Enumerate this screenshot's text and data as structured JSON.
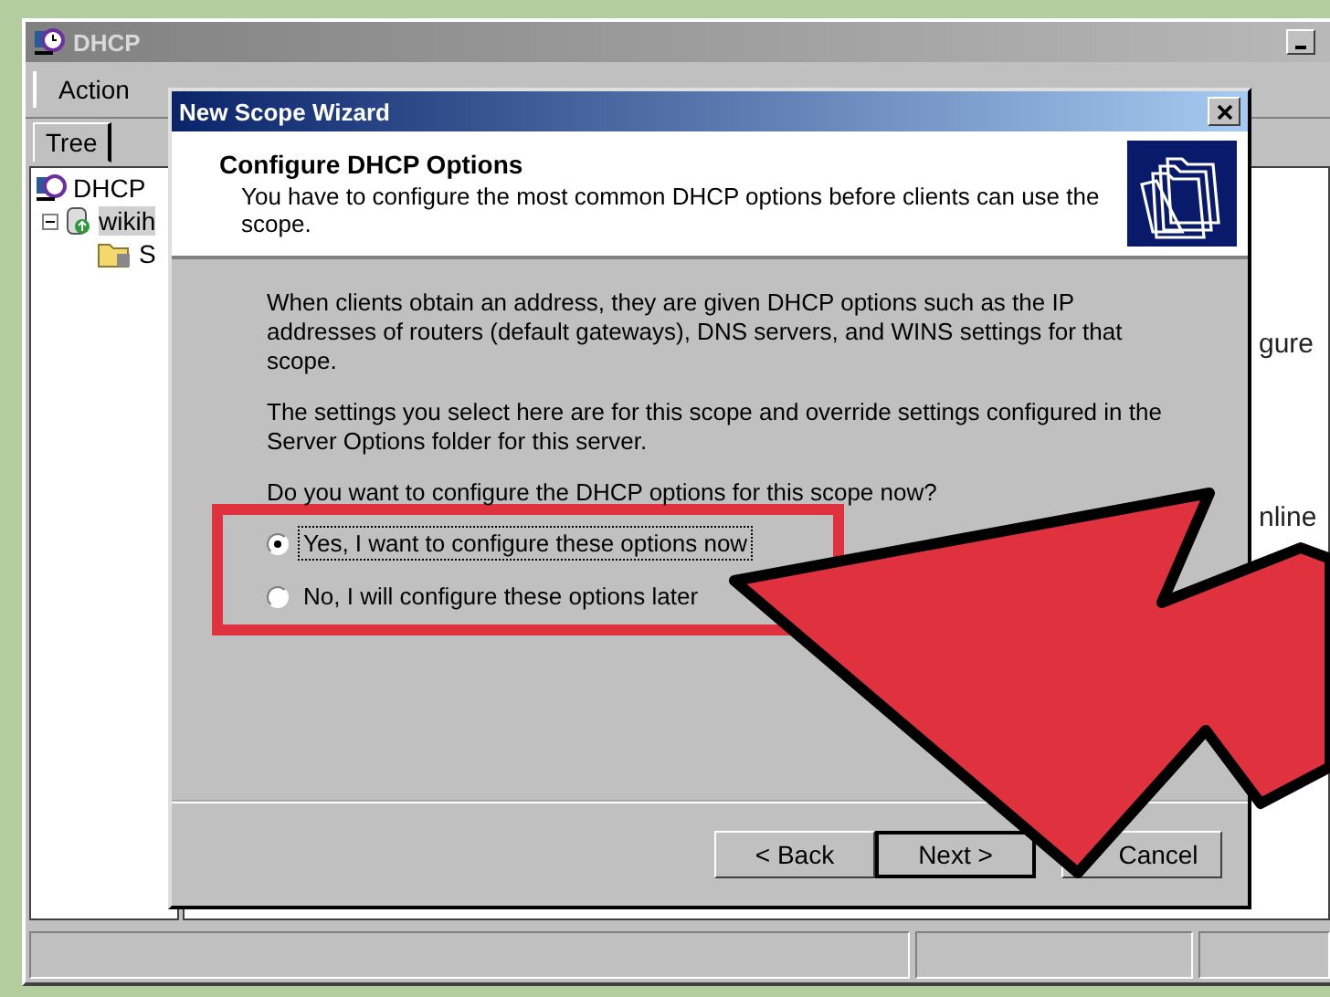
{
  "main_window": {
    "title": "DHCP",
    "menu": [
      "Action"
    ],
    "tabs": [
      {
        "label": "Tree",
        "selected": true
      }
    ],
    "tree": [
      {
        "label": "DHCP",
        "selected": false,
        "children": [
          {
            "label": "wikih",
            "selected": true,
            "expanded": true,
            "children": [
              {
                "label": "S",
                "selected": false
              }
            ]
          }
        ]
      }
    ],
    "details": [
      "gure",
      "nline"
    ]
  },
  "wizard": {
    "title": "New Scope Wizard",
    "heading": "Configure DHCP Options",
    "subheading": "You have to configure the most common DHCP options before clients can use the scope.",
    "paragraphs": [
      "When clients obtain an address, they are given DHCP options such as the IP addresses of routers (default gateways), DNS servers, and WINS settings for that scope.",
      "The settings you select here are for this scope and override settings configured in the Server Options folder for this server."
    ],
    "question": "Do you want to configure the DHCP options for this scope now?",
    "options": [
      {
        "label": "Yes, I want to configure these options now",
        "selected": true
      },
      {
        "label": "No, I will configure these options later",
        "selected": false
      }
    ],
    "buttons": [
      {
        "label": "< Back",
        "kind": "normal"
      },
      {
        "label": "Next >",
        "kind": "default"
      },
      {
        "label": "Cancel",
        "kind": "normal"
      }
    ]
  }
}
